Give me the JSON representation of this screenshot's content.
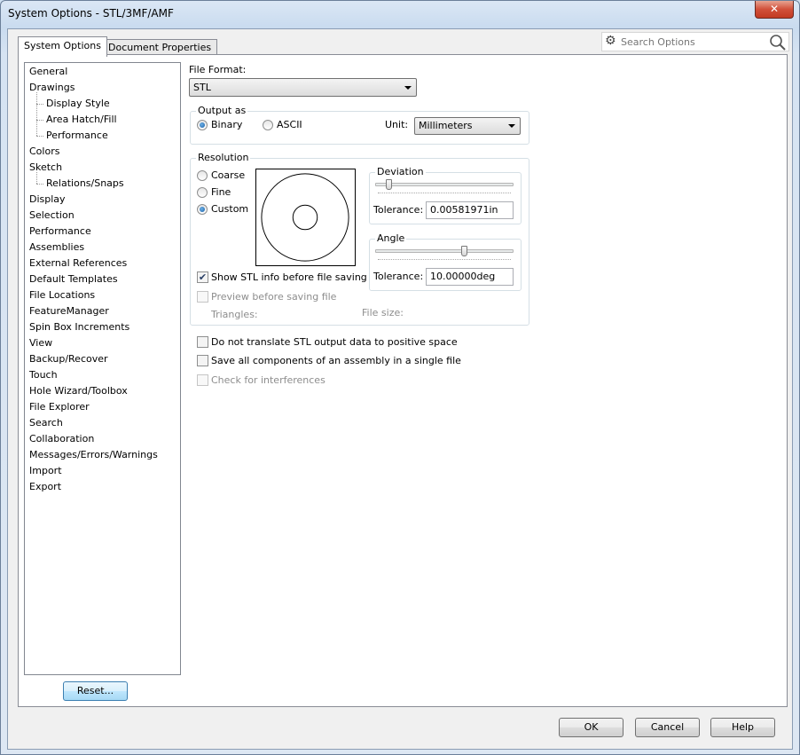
{
  "window": {
    "title": "System Options - STL/3MF/AMF",
    "close_glyph": "✕"
  },
  "tabs": [
    {
      "label": "System Options",
      "active": true
    },
    {
      "label": "Document Properties",
      "active": false
    }
  ],
  "search": {
    "placeholder": "Search Options",
    "icon": "gear-icon",
    "search_icon": "magnifier-icon"
  },
  "tree": {
    "items": [
      {
        "label": "General",
        "level": 0
      },
      {
        "label": "Drawings",
        "level": 0
      },
      {
        "label": "Display Style",
        "level": 1
      },
      {
        "label": "Area Hatch/Fill",
        "level": 1
      },
      {
        "label": "Performance",
        "level": 1
      },
      {
        "label": "Colors",
        "level": 0
      },
      {
        "label": "Sketch",
        "level": 0
      },
      {
        "label": "Relations/Snaps",
        "level": 1
      },
      {
        "label": "Display",
        "level": 0
      },
      {
        "label": "Selection",
        "level": 0
      },
      {
        "label": "Performance",
        "level": 0
      },
      {
        "label": "Assemblies",
        "level": 0
      },
      {
        "label": "External References",
        "level": 0
      },
      {
        "label": "Default Templates",
        "level": 0
      },
      {
        "label": "File Locations",
        "level": 0
      },
      {
        "label": "FeatureManager",
        "level": 0
      },
      {
        "label": "Spin Box Increments",
        "level": 0
      },
      {
        "label": "View",
        "level": 0
      },
      {
        "label": "Backup/Recover",
        "level": 0
      },
      {
        "label": "Touch",
        "level": 0
      },
      {
        "label": "Hole Wizard/Toolbox",
        "level": 0
      },
      {
        "label": "File Explorer",
        "level": 0
      },
      {
        "label": "Search",
        "level": 0
      },
      {
        "label": "Collaboration",
        "level": 0
      },
      {
        "label": "Messages/Errors/Warnings",
        "level": 0
      },
      {
        "label": "Import",
        "level": 0
      },
      {
        "label": "Export",
        "level": 0
      }
    ]
  },
  "reset_label": "Reset...",
  "file_format": {
    "label": "File Format:",
    "value": "STL"
  },
  "output_as": {
    "title": "Output as",
    "binary_label": "Binary",
    "ascii_label": "ASCII",
    "selected": "Binary",
    "unit_label": "Unit:",
    "unit_value": "Millimeters"
  },
  "resolution": {
    "title": "Resolution",
    "coarse_label": "Coarse",
    "fine_label": "Fine",
    "custom_label": "Custom",
    "selected": "Custom",
    "deviation": {
      "title": "Deviation",
      "tolerance_label": "Tolerance:",
      "tolerance_value": "0.00581971in",
      "slider_level": 0.08
    },
    "angle": {
      "title": "Angle",
      "tolerance_label": "Tolerance:",
      "tolerance_value": "10.00000deg",
      "slider_level": 0.65
    },
    "show_info_label": "Show STL info before file saving",
    "show_info_checked": true,
    "preview_label": "Preview before saving file",
    "preview_checked": false,
    "triangles_label": "Triangles:",
    "file_size_label": "File size:"
  },
  "options": {
    "no_translate_label": "Do not translate STL output data to positive space",
    "save_all_label": "Save all components of an assembly in a single file",
    "check_interferences_label": "Check for interferences"
  },
  "buttons": {
    "ok": "OK",
    "cancel": "Cancel",
    "help": "Help"
  }
}
